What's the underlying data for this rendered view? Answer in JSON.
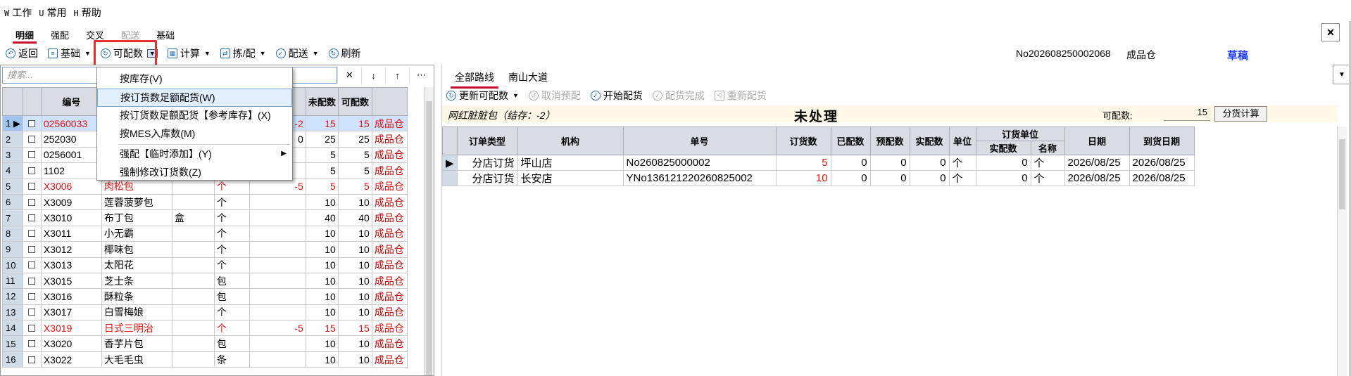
{
  "menubar": [
    {
      "key": "W",
      "label": "工作"
    },
    {
      "key": "U",
      "label": "常用"
    },
    {
      "key": "H",
      "label": "帮助"
    }
  ],
  "tabs": [
    {
      "label": "明细",
      "active": true
    },
    {
      "label": "强配"
    },
    {
      "label": "交叉"
    },
    {
      "label": "配送",
      "disabled": true
    },
    {
      "label": "基础"
    }
  ],
  "close": "×",
  "toolbar": {
    "back": "返回",
    "basic": "基础",
    "available": "可配数",
    "calc": "计算",
    "pick": "拣/配",
    "deliver": "配送",
    "refresh": "刷新"
  },
  "header": {
    "doc_no": "No202608250002068",
    "warehouse": "成品仓",
    "status": "草稿"
  },
  "search": {
    "placeholder": "搜索..."
  },
  "left_grid": {
    "headers": [
      "",
      "",
      "编号",
      "",
      "",
      "",
      "",
      "未配数",
      "可配数",
      ""
    ],
    "rows": [
      {
        "n": "1",
        "code": "02560033",
        "name": "",
        "pkg": "",
        "unit": "",
        "diff": "-2",
        "un": "15",
        "av": "15",
        "wh": "成品仓",
        "red": true,
        "sel": true
      },
      {
        "n": "2",
        "code": "252030",
        "name": "",
        "pkg": "",
        "unit": "",
        "diff": "0",
        "un": "25",
        "av": "25",
        "wh": "成品仓"
      },
      {
        "n": "3",
        "code": "0256001",
        "name": "",
        "pkg": "",
        "unit": "",
        "diff": "",
        "un": "5",
        "av": "5",
        "wh": "成品仓"
      },
      {
        "n": "4",
        "code": "1102",
        "name": "",
        "pkg": "",
        "unit": "",
        "diff": "",
        "un": "5",
        "av": "5",
        "wh": "成品仓"
      },
      {
        "n": "5",
        "code": "X3006",
        "name": "肉松包",
        "pkg": "",
        "unit": "个",
        "diff": "-5",
        "un": "5",
        "av": "5",
        "wh": "成品仓",
        "red": true
      },
      {
        "n": "6",
        "code": "X3009",
        "name": "莲蓉菠萝包",
        "pkg": "",
        "unit": "个",
        "diff": "",
        "un": "10",
        "av": "10",
        "wh": "成品仓"
      },
      {
        "n": "7",
        "code": "X3010",
        "name": "布丁包",
        "pkg": "盒",
        "unit": "个",
        "diff": "",
        "un": "40",
        "av": "40",
        "wh": "成品仓"
      },
      {
        "n": "8",
        "code": "X3011",
        "name": "小无霸",
        "pkg": "",
        "unit": "个",
        "diff": "",
        "un": "10",
        "av": "10",
        "wh": "成品仓"
      },
      {
        "n": "9",
        "code": "X3012",
        "name": "椰味包",
        "pkg": "",
        "unit": "个",
        "diff": "",
        "un": "10",
        "av": "10",
        "wh": "成品仓"
      },
      {
        "n": "10",
        "code": "X3013",
        "name": "太阳花",
        "pkg": "",
        "unit": "个",
        "diff": "",
        "un": "10",
        "av": "10",
        "wh": "成品仓"
      },
      {
        "n": "11",
        "code": "X3015",
        "name": "芝士条",
        "pkg": "",
        "unit": "包",
        "diff": "",
        "un": "10",
        "av": "10",
        "wh": "成品仓"
      },
      {
        "n": "12",
        "code": "X3016",
        "name": "酥粒条",
        "pkg": "",
        "unit": "包",
        "diff": "",
        "un": "10",
        "av": "10",
        "wh": "成品仓"
      },
      {
        "n": "13",
        "code": "X3017",
        "name": "白雪梅娘",
        "pkg": "",
        "unit": "个",
        "diff": "",
        "un": "10",
        "av": "10",
        "wh": "成品仓"
      },
      {
        "n": "14",
        "code": "X3019",
        "name": "日式三明治",
        "pkg": "",
        "unit": "个",
        "diff": "-5",
        "un": "15",
        "av": "15",
        "wh": "成品仓",
        "red": true
      },
      {
        "n": "15",
        "code": "X3020",
        "name": "香芋片包",
        "pkg": "",
        "unit": "包",
        "diff": "",
        "un": "10",
        "av": "10",
        "wh": "成品仓"
      },
      {
        "n": "16",
        "code": "X3022",
        "name": "大毛毛虫",
        "pkg": "",
        "unit": "条",
        "diff": "",
        "un": "10",
        "av": "10",
        "wh": "成品仓"
      }
    ]
  },
  "dropdown": {
    "items": [
      {
        "label": "按库存(V)"
      },
      {
        "label": "按订货数足额配货(W)",
        "highlight": true
      },
      {
        "label": "按订货数足额配货【参考库存】(X)"
      },
      {
        "label": "按MES入库数(M)"
      },
      {
        "label": "强配【临时添加】(Y)",
        "submenu": true,
        "sep_before": true
      },
      {
        "label": "强制修改订货数(Z)"
      }
    ]
  },
  "route_tabs": [
    "全部路线",
    "南山大道"
  ],
  "rtoolbar": {
    "update": "更新可配数",
    "cancel": "取消预配",
    "start": "开始配货",
    "done": "配货完成",
    "redo": "重新配货"
  },
  "info": {
    "product": "网红脏脏包（结存：-2）",
    "title": "未处理",
    "avail_label": "可配数:",
    "avail_value": "15",
    "split_btn": "分货计算"
  },
  "right_grid": {
    "headers": {
      "order_type": "订单类型",
      "org": "机构",
      "bill_no": "单号",
      "order_qty": "订货数",
      "matched": "已配数",
      "pre": "预配数",
      "actual": "实配数",
      "unit": "单位",
      "order_unit": "订货单位",
      "ou_actual": "实配数",
      "ou_name": "名称",
      "date": "日期",
      "arrive": "到货日期"
    },
    "rows": [
      {
        "type": "分店订货",
        "org": "坪山店",
        "no": "No260825000002",
        "qty": "5",
        "matched": "0",
        "pre": "0",
        "actual": "0",
        "unit": "个",
        "ou_actual": "0",
        "ou_name": "个",
        "date": "2026/08/25",
        "arrive": "2026/08/25"
      },
      {
        "type": "分店订货",
        "org": "长安店",
        "no": "YNo136121220260825002",
        "qty": "10",
        "matched": "0",
        "pre": "0",
        "actual": "0",
        "unit": "个",
        "ou_actual": "0",
        "ou_name": "个",
        "date": "2026/08/25",
        "arrive": "2026/08/25"
      }
    ]
  }
}
